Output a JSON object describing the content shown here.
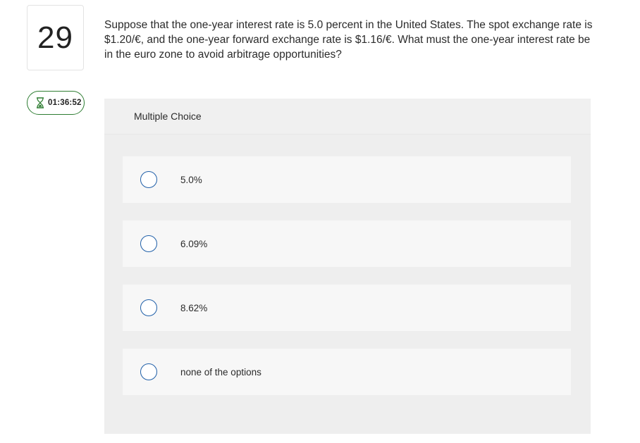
{
  "question": {
    "number": "29",
    "text": "Suppose that the one-year interest rate is 5.0 percent in the United States. The spot exchange rate is $1.20/€, and the one-year forward exchange rate is $1.16/€. What must the one-year interest rate be in the euro zone to avoid arbitrage opportunities?"
  },
  "timer": {
    "icon": "hourglass-icon",
    "value": "01:36:52",
    "color": "#2e7d32"
  },
  "choices": {
    "header": "Multiple Choice",
    "options": [
      {
        "label": "5.0%"
      },
      {
        "label": "6.09%"
      },
      {
        "label": "8.62%"
      },
      {
        "label": "none of the options"
      }
    ]
  },
  "colors": {
    "radio_border": "#1f5fa8",
    "panel_bg": "#eeeeee",
    "option_bg": "#f7f7f7"
  }
}
